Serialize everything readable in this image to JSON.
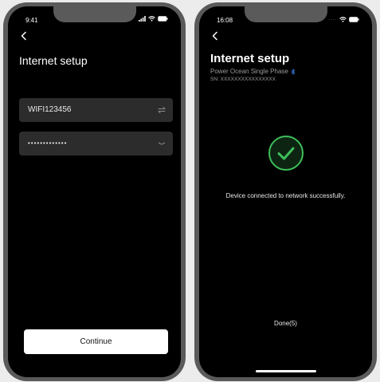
{
  "left_screen": {
    "status_time": "9:41",
    "title": "Internet setup",
    "wifi_field": {
      "value": "WIFI123456",
      "icon": "swap-arrows-icon"
    },
    "password_field": {
      "value": "•••••••••••••",
      "icon": "chevron-down-icon"
    },
    "continue_label": "Continue"
  },
  "right_screen": {
    "status_time": "16:08",
    "status_dots": "....",
    "title": "Internet setup",
    "device_name": "Power Ocean Single Phase",
    "sn_label": "SN: XXXXXXXXXXXXXXXX",
    "success_icon": "check-circle-icon",
    "message": "Device connected to network successfully.",
    "done_label": "Done(5)"
  },
  "colors": {
    "success_green": "#3fbf5a",
    "bluetooth_blue": "#3d7be6",
    "field_bg": "#2c2c2c",
    "frame": "#5a5a5a"
  }
}
